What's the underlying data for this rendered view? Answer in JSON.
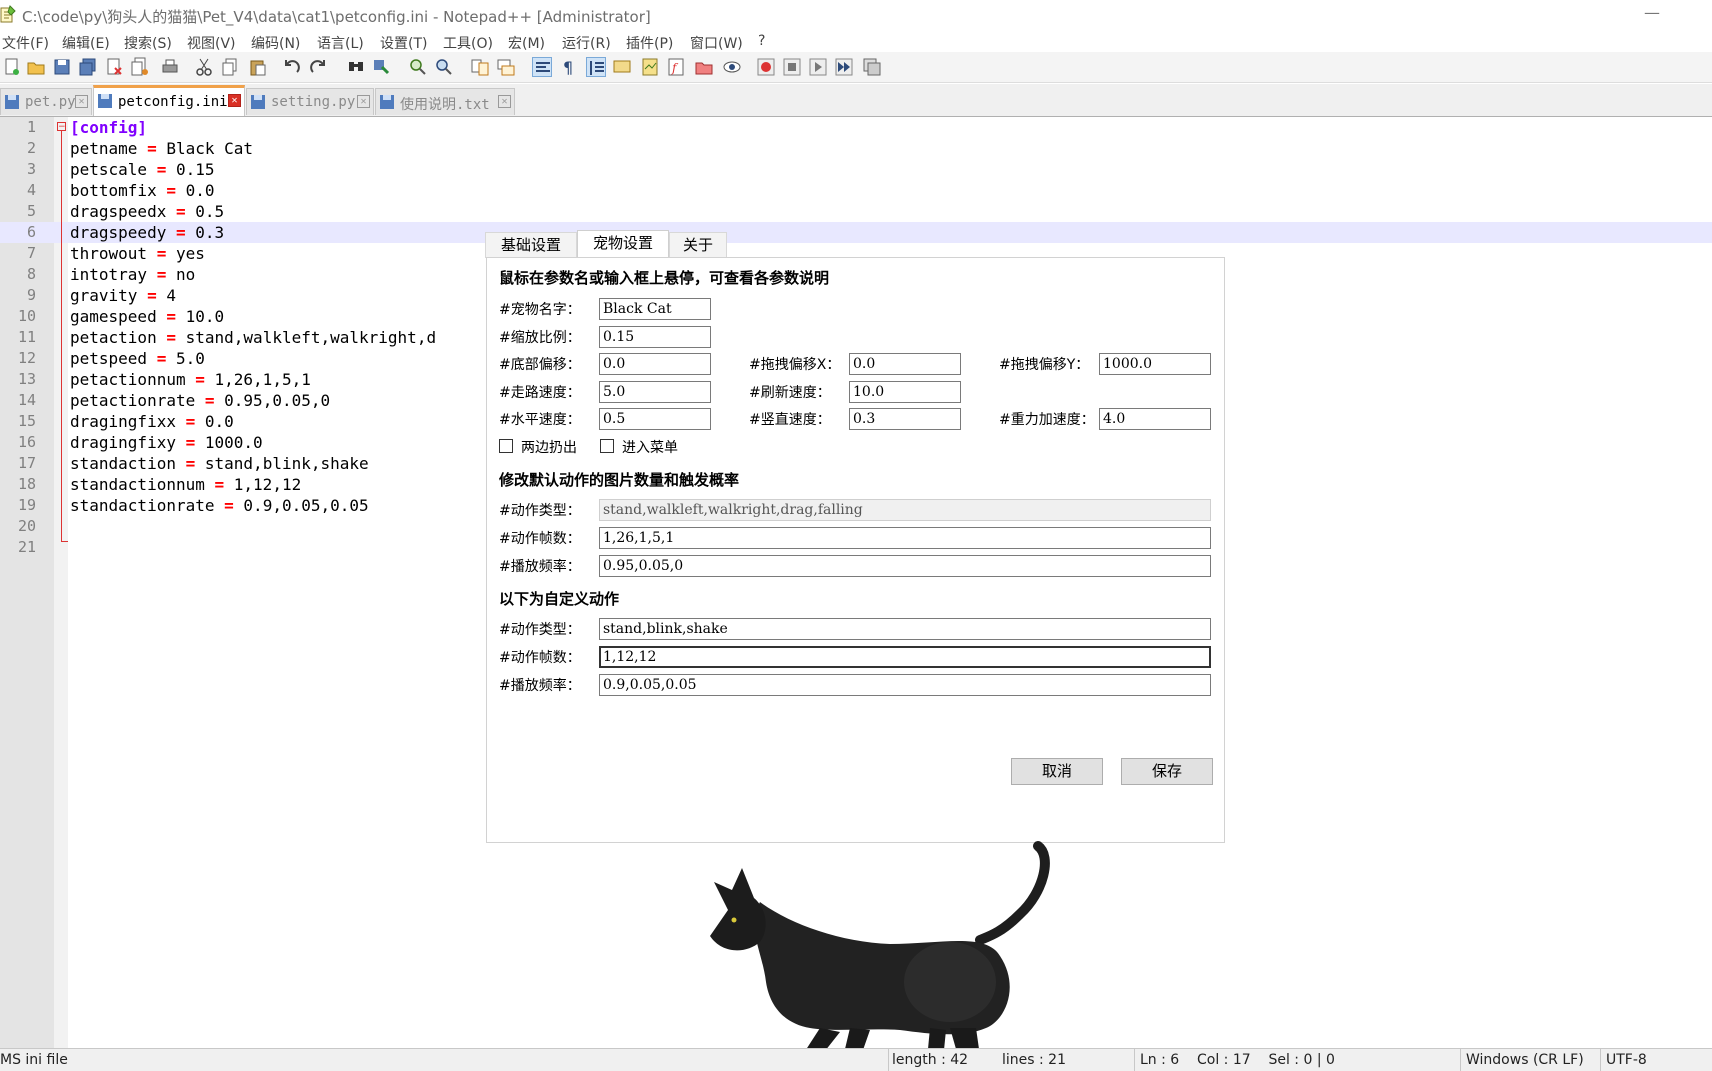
{
  "window": {
    "title": "C:\\code\\py\\狗头人的猫猫\\Pet_V4\\data\\cat1\\petconfig.ini - Notepad++ [Administrator]",
    "minimize": "—"
  },
  "menu": [
    "文件(F)",
    "编辑(E)",
    "搜索(S)",
    "视图(V)",
    "编码(N)",
    "语言(L)",
    "设置(T)",
    "工具(O)",
    "宏(M)",
    "运行(R)",
    "插件(P)",
    "窗口(W)",
    "?"
  ],
  "tabs": [
    {
      "label": "pet.py",
      "active": false
    },
    {
      "label": "petconfig.ini",
      "active": true
    },
    {
      "label": "setting.py",
      "active": false
    },
    {
      "label": "使用说明.txt",
      "active": false
    }
  ],
  "editor": {
    "current_line": 6,
    "lines": [
      {
        "n": "1",
        "section": "[config]"
      },
      {
        "n": "2",
        "key": "petname",
        "op": "=",
        "value": "Black Cat"
      },
      {
        "n": "3",
        "key": "petscale",
        "op": "=",
        "value": "0.15"
      },
      {
        "n": "4",
        "key": "bottomfix",
        "op": "=",
        "value": "0.0"
      },
      {
        "n": "5",
        "key": "dragspeedx",
        "op": "=",
        "value": "0.5"
      },
      {
        "n": "6",
        "key": "dragspeedy",
        "op": "=",
        "value": "0.3"
      },
      {
        "n": "7",
        "key": "throwout",
        "op": "=",
        "value": "yes"
      },
      {
        "n": "8",
        "key": "intotray",
        "op": "=",
        "value": "no"
      },
      {
        "n": "9",
        "key": "gravity",
        "op": "=",
        "value": "4"
      },
      {
        "n": "10",
        "key": "gamespeed",
        "op": "=",
        "value": "10.0"
      },
      {
        "n": "11",
        "key": "petaction",
        "op": "=",
        "value": "stand,walkleft,walkright,d"
      },
      {
        "n": "12",
        "key": "petspeed",
        "op": "=",
        "value": "5.0"
      },
      {
        "n": "13",
        "key": "petactionnum",
        "op": "=",
        "value": "1,26,1,5,1"
      },
      {
        "n": "14",
        "key": "petactionrate",
        "op": "=",
        "value": "0.95,0.05,0"
      },
      {
        "n": "15",
        "key": "dragingfixx",
        "op": "=",
        "value": "0.0"
      },
      {
        "n": "16",
        "key": "dragingfixy",
        "op": "=",
        "value": "1000.0"
      },
      {
        "n": "17",
        "key": "standaction",
        "op": "=",
        "value": "stand,blink,shake"
      },
      {
        "n": "18",
        "key": "standactionnum",
        "op": "=",
        "value": "1,12,12"
      },
      {
        "n": "19",
        "key": "standactionrate",
        "op": "=",
        "value": "0.9,0.05,0.05"
      },
      {
        "n": "20"
      },
      {
        "n": "21"
      }
    ]
  },
  "status": {
    "filetype": "MS ini file",
    "length": "length : 42",
    "lines": "lines : 21",
    "pos": "Ln : 6    Col : 17    Sel : 0 | 0",
    "eol": "Windows (CR LF)",
    "encoding": "UTF-8"
  },
  "dialog": {
    "tabs": [
      "基础设置",
      "宠物设置",
      "关于"
    ],
    "active_tab": 1,
    "hint": "鼠标在参数名或输入框上悬停，可查看各参数说明",
    "fields": {
      "name_label": "#宠物名字：",
      "name": "Black Cat",
      "scale_label": "#缩放比例：",
      "scale": "0.15",
      "bottom_label": "#底部偏移：",
      "bottom": "0.0",
      "dragx_label": "#拖拽偏移X：",
      "dragx": "0.0",
      "dragy_label": "#拖拽偏移Y：",
      "dragy": "1000.0",
      "walk_label": "#走路速度：",
      "walk": "5.0",
      "refresh_label": "#刷新速度：",
      "refresh": "10.0",
      "hspeed_label": "#水平速度：",
      "hspeed": "0.5",
      "vspeed_label": "#竖直速度：",
      "vspeed": "0.3",
      "gravity_label": "#重力加速度：",
      "gravity": "4.0"
    },
    "checkboxes": {
      "throwout": "两边扔出",
      "intotray": "进入菜单"
    },
    "default_section": "修改默认动作的图片数量和触发概率",
    "default": {
      "type_label": "#动作类型：",
      "type": "stand,walkleft,walkright,drag,falling",
      "frames_label": "#动作帧数：",
      "frames": "1,26,1,5,1",
      "rate_label": "#播放频率：",
      "rate": "0.95,0.05,0"
    },
    "custom_section": "以下为自定义动作",
    "custom": {
      "type_label": "#动作类型：",
      "type": "stand,blink,shake",
      "frames_label": "#动作帧数：",
      "frames": "1,12,12",
      "rate_label": "#播放频率：",
      "rate": "0.9,0.05,0.05"
    },
    "cancel": "取消",
    "save": "保存"
  }
}
